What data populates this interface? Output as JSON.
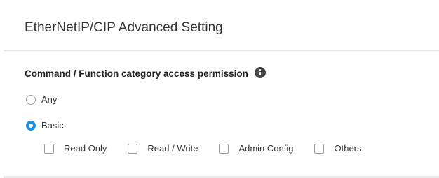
{
  "panel": {
    "title": "EtherNetIP/CIP Advanced Setting"
  },
  "access": {
    "title": "Command / Function category access permission",
    "info_icon": "info-icon",
    "radios": [
      {
        "label": "Any",
        "checked": false
      },
      {
        "label": "Basic",
        "checked": true
      }
    ],
    "checkboxes": [
      {
        "label": "Read Only",
        "checked": false
      },
      {
        "label": "Read / Write",
        "checked": false
      },
      {
        "label": "Admin Config",
        "checked": false
      },
      {
        "label": "Others",
        "checked": false
      }
    ]
  },
  "colors": {
    "accent": "#1a8fe6",
    "text": "#333333",
    "divider": "#e3e3e3"
  }
}
